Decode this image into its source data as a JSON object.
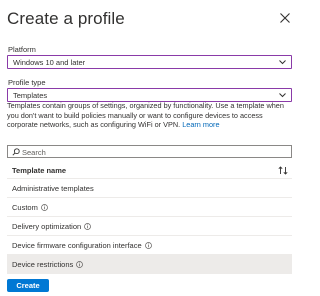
{
  "panel": {
    "title": "Create a profile"
  },
  "platform": {
    "label": "Platform",
    "value": "Windows 10 and later"
  },
  "profile_type": {
    "label": "Profile type",
    "value": "Templates"
  },
  "description": {
    "text": "Templates contain groups of settings, organized by functionality. Use a template when you don't want to build policies manually or want to configure devices to access corporate networks, such as configuring WiFi or VPN.",
    "link": "Learn more"
  },
  "search": {
    "placeholder": "Search"
  },
  "table": {
    "header": "Template name",
    "rows": [
      {
        "name": "Administrative templates",
        "info": false,
        "selected": false
      },
      {
        "name": "Custom",
        "info": true,
        "selected": false
      },
      {
        "name": "Delivery optimization",
        "info": true,
        "selected": false
      },
      {
        "name": "Device firmware configuration interface",
        "info": true,
        "selected": false
      },
      {
        "name": "Device restrictions",
        "info": true,
        "selected": true
      }
    ]
  },
  "actions": {
    "create_label": "Create"
  },
  "colors": {
    "accent": "#0078d4",
    "dropdown_border": "#8a3aa8",
    "link": "#0067b8",
    "selected_row": "#edebe9"
  }
}
